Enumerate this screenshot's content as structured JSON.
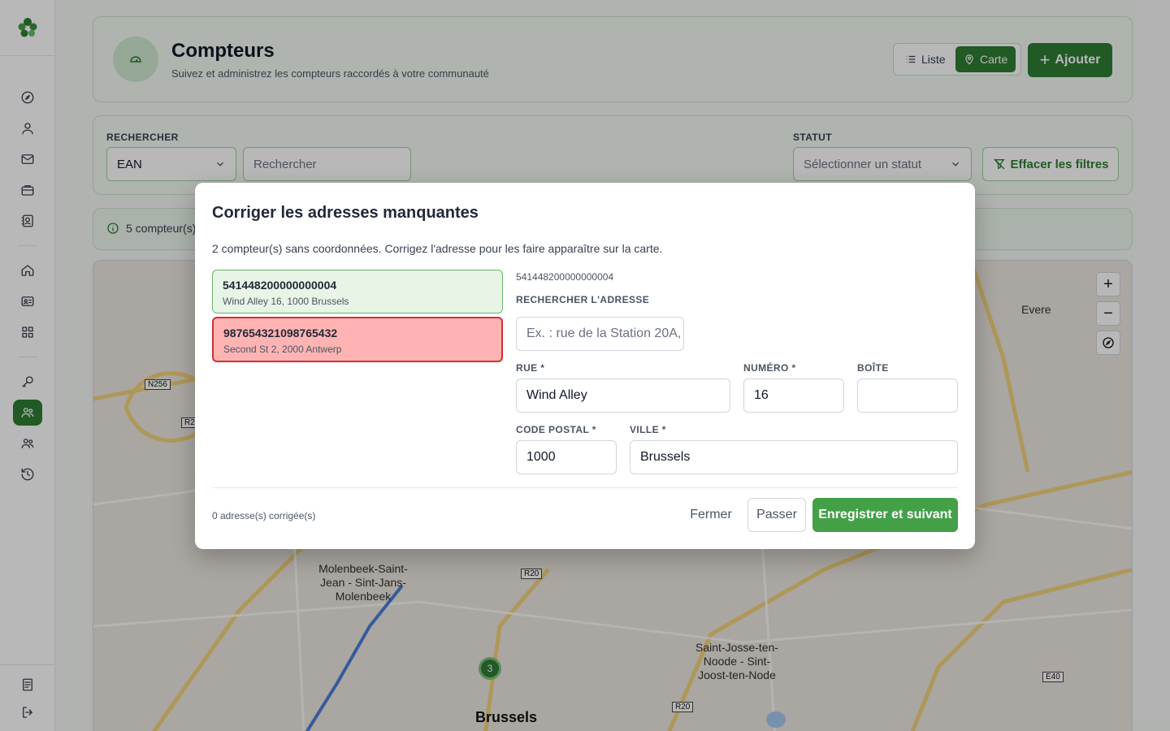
{
  "colors": {
    "brand": "#2e7d32",
    "brand_light": "#cfe8cf",
    "error_bg": "#ffb3b3",
    "error_border": "#d32f2f",
    "success_bg": "#e6f5e6"
  },
  "sidebar": {
    "items": [
      {
        "name": "compass-icon"
      },
      {
        "name": "user-icon"
      },
      {
        "name": "mail-icon"
      },
      {
        "name": "briefcase-icon"
      },
      {
        "name": "contact-card-icon"
      },
      {
        "name": "home-icon"
      },
      {
        "name": "id-card-icon"
      },
      {
        "name": "grid-icon"
      },
      {
        "name": "key-icon"
      },
      {
        "name": "meters-icon",
        "active": true
      },
      {
        "name": "users-icon"
      },
      {
        "name": "history-icon"
      },
      {
        "name": "document-icon"
      },
      {
        "name": "logout-icon"
      }
    ]
  },
  "header": {
    "title": "Compteurs",
    "subtitle": "Suivez et administrez les compteurs raccordés à votre communauté",
    "view_list": "Liste",
    "view_map": "Carte",
    "add_label": "Ajouter"
  },
  "filters": {
    "search_label": "RECHERCHER",
    "search_field": "EAN",
    "search_placeholder": "Rechercher",
    "status_label": "STATUT",
    "status_placeholder": "Sélectionner un statut",
    "clear_label": "Effacer les filtres"
  },
  "info_bar": {
    "text": "5 compteur(s)"
  },
  "map": {
    "labels": [
      "Evere",
      "Molenbeek-Saint-Jean - Sint-Jans-Molenbeek",
      "Saint-Josse-ten-Noode - Sint-Joost-ten-Node",
      "Brussels"
    ],
    "road_tags": [
      "N256",
      "R20",
      "R20",
      "R20",
      "E40"
    ],
    "cluster_count": "3",
    "zoom_in": "+",
    "zoom_out": "−"
  },
  "modal": {
    "title": "Corriger les adresses manquantes",
    "description": "2 compteur(s) sans coordonnées. Corrigez l'adresse pour les faire apparaître sur la carte.",
    "meters": [
      {
        "ean": "541448200000000004",
        "address": "Wind Alley 16, 1000 Brussels",
        "state": "selected"
      },
      {
        "ean": "987654321098765432",
        "address": "Second St 2, 2000 Antwerp",
        "state": "error"
      }
    ],
    "selected_ean": "541448200000000004",
    "search_address_label": "RECHERCHER L'ADRESSE",
    "search_address_placeholder": "Ex. : rue de la Station 20A,",
    "street_label": "RUE *",
    "street_value": "Wind Alley",
    "number_label": "NUMÉRO *",
    "number_value": "16",
    "box_label": "BOÎTE",
    "box_value": "",
    "postal_label": "CODE POSTAL *",
    "postal_value": "1000",
    "city_label": "VILLE *",
    "city_value": "Brussels",
    "corrected_count": "0 adresse(s) corrigée(s)",
    "close_label": "Fermer",
    "skip_label": "Passer",
    "save_label": "Enregistrer et suivant"
  }
}
